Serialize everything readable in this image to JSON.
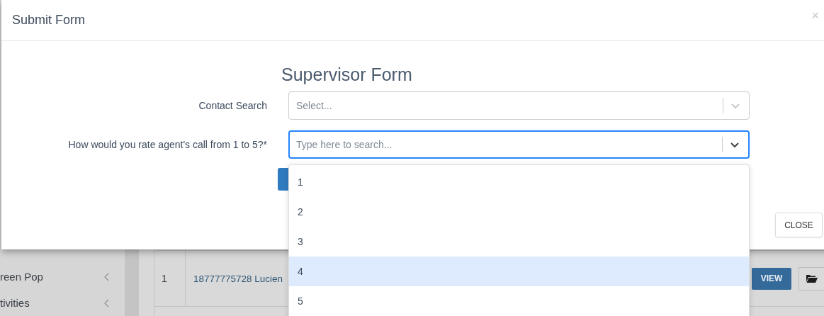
{
  "background": {
    "sidebar_items": [
      {
        "label": "reen Pop"
      },
      {
        "label": "tivities"
      }
    ],
    "table_rows": [
      {
        "number": "1",
        "contact": "18777775728 Lucien",
        "action": "VIEW"
      }
    ]
  },
  "modal": {
    "title": "Submit Form",
    "close_symbol": "×",
    "form_title": "Supervisor Form",
    "fields": [
      {
        "label": "Contact Search",
        "placeholder": "Select...",
        "focused": false
      },
      {
        "label": "How would you rate agent's call from 1 to 5?*",
        "placeholder": "Type here to search...",
        "focused": true
      }
    ],
    "close_button": "CLOSE"
  },
  "dropdown": {
    "options": [
      {
        "label": "1",
        "selected": false
      },
      {
        "label": "2",
        "selected": false
      },
      {
        "label": "3",
        "selected": false
      },
      {
        "label": "4",
        "selected": true
      },
      {
        "label": "5",
        "selected": false
      }
    ]
  }
}
